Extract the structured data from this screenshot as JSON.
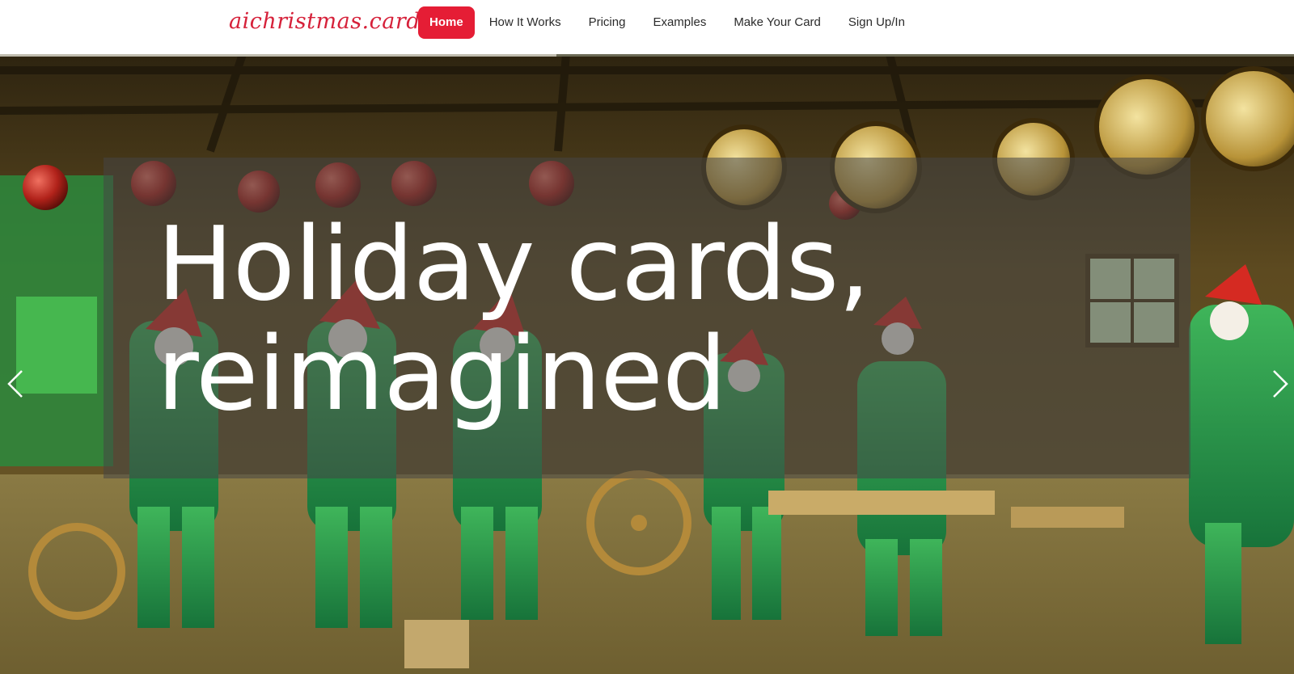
{
  "brand": {
    "logo_text": "aichristmas.cards",
    "accent_color": "#e51d35"
  },
  "nav": {
    "items": [
      {
        "label": "Home",
        "active": true
      },
      {
        "label": "How It Works",
        "active": false
      },
      {
        "label": "Pricing",
        "active": false
      },
      {
        "label": "Examples",
        "active": false
      },
      {
        "label": "Make Your Card",
        "active": false
      },
      {
        "label": "Sign Up/In",
        "active": false
      }
    ]
  },
  "hero": {
    "headline_line1": "Holiday cards,",
    "headline_line2": "reimagined",
    "slide_progress": 0.43,
    "prev_icon": "chevron-left-icon",
    "next_icon": "chevron-right-icon"
  }
}
